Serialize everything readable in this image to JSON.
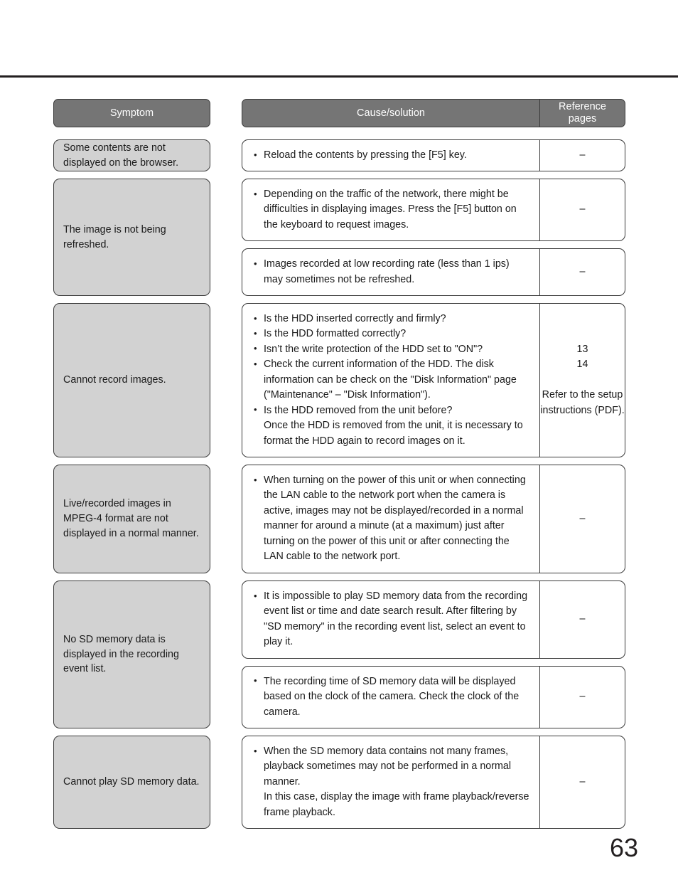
{
  "page": {
    "number": "63"
  },
  "table": {
    "headers": {
      "symptom": "Symptom",
      "cause_solution": "Cause/solution",
      "reference_pages": "Reference\npages"
    },
    "sections": [
      {
        "symptom": "Some contents are not displayed on the browser.",
        "rows": [
          {
            "bullets": [
              {
                "text": "Reload the contents by pressing the [F5] key.",
                "bullet": true
              }
            ],
            "reference": "–"
          }
        ]
      },
      {
        "symptom": "The image is not being refreshed.",
        "rows": [
          {
            "bullets": [
              {
                "text": "Depending on the traffic of the network, there might be difficulties in displaying images. Press the [F5] button on the keyboard to request images.",
                "bullet": true
              }
            ],
            "reference": "–"
          },
          {
            "bullets": [
              {
                "text": "Images recorded at low recording rate (less than 1 ips) may sometimes not be refreshed.",
                "bullet": true
              }
            ],
            "reference": "–"
          }
        ]
      },
      {
        "symptom": "Cannot record images.",
        "rows": [
          {
            "bullets": [
              {
                "text": "Is the HDD inserted correctly and firmly?",
                "bullet": true
              },
              {
                "text": "Is the HDD formatted correctly?",
                "bullet": true
              },
              {
                "text": "Isn’t the write protection of the HDD set to \"ON\"?",
                "bullet": true
              },
              {
                "text": "Check the current information of the HDD. The disk information can be check on the \"Disk Information\" page (\"Maintenance\" – \"Disk Information\").",
                "bullet": true
              },
              {
                "text": "Is the HDD removed from the unit before?",
                "bullet": true
              },
              {
                "text": "Once the HDD is removed from the unit, it is necessary to format the HDD again to record images on it.",
                "bullet": false
              }
            ],
            "reference": "13\n14\n\nRefer to the setup instructions (PDF)."
          }
        ]
      },
      {
        "symptom": "Live/recorded images in MPEG-4 format are not displayed in a normal manner.",
        "rows": [
          {
            "bullets": [
              {
                "text": "When turning on the power of this unit or when connecting the LAN cable to the network port when the camera is active, images may not be displayed/recorded in a normal manner for around a minute (at a maximum) just after turning on the power of this unit or after connecting the LAN cable to the network port.",
                "bullet": true
              }
            ],
            "reference": "–"
          }
        ]
      },
      {
        "symptom": "No SD memory data is displayed in the recording event list.",
        "rows": [
          {
            "bullets": [
              {
                "text": "It is impossible to play SD memory data from the recording event list or time and date search result. After filtering by \"SD memory\" in the recording event list, select an event to play it.",
                "bullet": true
              }
            ],
            "reference": "–"
          },
          {
            "bullets": [
              {
                "text": "The recording time of SD memory data will be displayed based on the clock of the camera. Check the clock of the camera.",
                "bullet": true
              }
            ],
            "reference": "–"
          }
        ]
      },
      {
        "symptom": "Cannot play SD memory data.",
        "rows": [
          {
            "bullets": [
              {
                "text": "When the SD memory data contains not many frames, playback sometimes may not be performed in a normal manner.",
                "bullet": true
              },
              {
                "text": "In this case, display the image with frame playback/reverse frame playback.",
                "bullet": false
              }
            ],
            "reference": "–"
          }
        ]
      }
    ]
  },
  "colors": {
    "header_gray": "#757575",
    "symptom_gray": "#d2d2d2",
    "arrow_gray": "#7b7b7b",
    "rule_black": "#231f20"
  }
}
